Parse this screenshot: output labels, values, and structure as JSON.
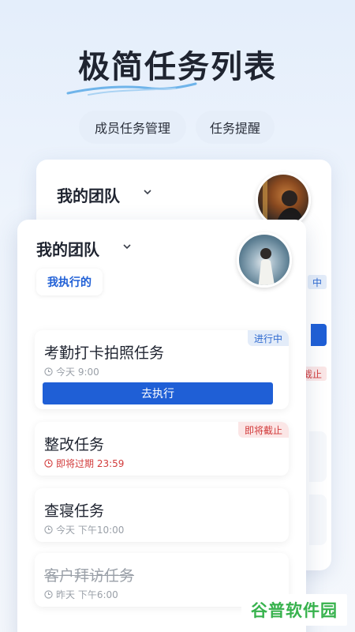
{
  "promo": {
    "headline": "极简任务列表",
    "pills": [
      "成员任务管理",
      "任务提醒"
    ]
  },
  "back_card": {
    "title": "我的团队",
    "tags": [
      "中",
      "截止"
    ]
  },
  "front_card": {
    "title": "我的团队",
    "filter_chip": "我执行的",
    "tasks": [
      {
        "title": "考勤打卡拍照任务",
        "time": "今天 9:00",
        "status": "进行中",
        "action": "去执行"
      },
      {
        "title": "整改任务",
        "time": "即将过期 23:59",
        "status": "即将截止"
      },
      {
        "title": "查寝任务",
        "time": "今天 下午10:00"
      },
      {
        "title": "客户拜访任务",
        "time": "昨天 下午6:00"
      }
    ]
  },
  "watermark": "谷普软件园",
  "colors": {
    "accent": "#1f5fd6",
    "danger": "#d23b3b",
    "background": "#e8f0fb"
  }
}
